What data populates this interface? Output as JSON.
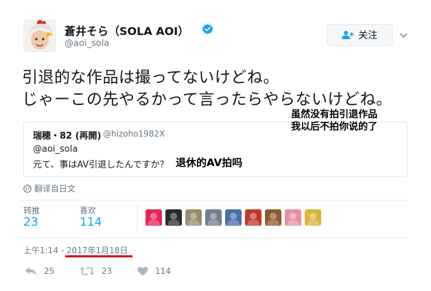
{
  "header": {
    "display_name": "蒼井そら（SOLA AOI）",
    "handle": "@aoi_sola",
    "follow_label": "关注"
  },
  "tweet": {
    "line1": "引退的な作品は撮ってないけどね。",
    "line2": "じゃーこの先やるかって言ったらやらないけどね。"
  },
  "overlay_notes": {
    "note1": "虽然没有拍引退作品",
    "note2": "我以后不拍你说的了",
    "quote_note": "退休的AV拍吗"
  },
  "quoted_tweet": {
    "name": "瑞穂・82 (再開)",
    "handle": "@hizoho1982X",
    "line1": "@aoi_sola",
    "line2": "元て、事はAV引退したんですか？"
  },
  "translate_label": "翻译自日文",
  "stats": {
    "retweets_label": "转推",
    "retweets": "23",
    "likes_label": "喜欢",
    "likes": "114"
  },
  "liker_avatars": [
    {
      "name": "avatar-1",
      "color": "#e8245a"
    },
    {
      "name": "avatar-2",
      "color": "#2b2b2b"
    },
    {
      "name": "avatar-3",
      "color": "#9a8b6e"
    },
    {
      "name": "avatar-4",
      "color": "#6f7f8f"
    },
    {
      "name": "avatar-5",
      "color": "#4a6fa5"
    },
    {
      "name": "avatar-6",
      "color": "#c0392b"
    },
    {
      "name": "avatar-7",
      "color": "#8e5a2e"
    },
    {
      "name": "avatar-8",
      "color": "#e58fa4"
    },
    {
      "name": "avatar-9",
      "color": "#d9b53d"
    }
  ],
  "timestamp": {
    "time": "上午1:14 - ",
    "date": "2017年1月18日"
  },
  "actions": {
    "replies": "25",
    "retweets": "23",
    "likes": "114"
  },
  "colors": {
    "accent": "#1da1f2",
    "muted": "#657786",
    "underline": "#d0021b"
  }
}
